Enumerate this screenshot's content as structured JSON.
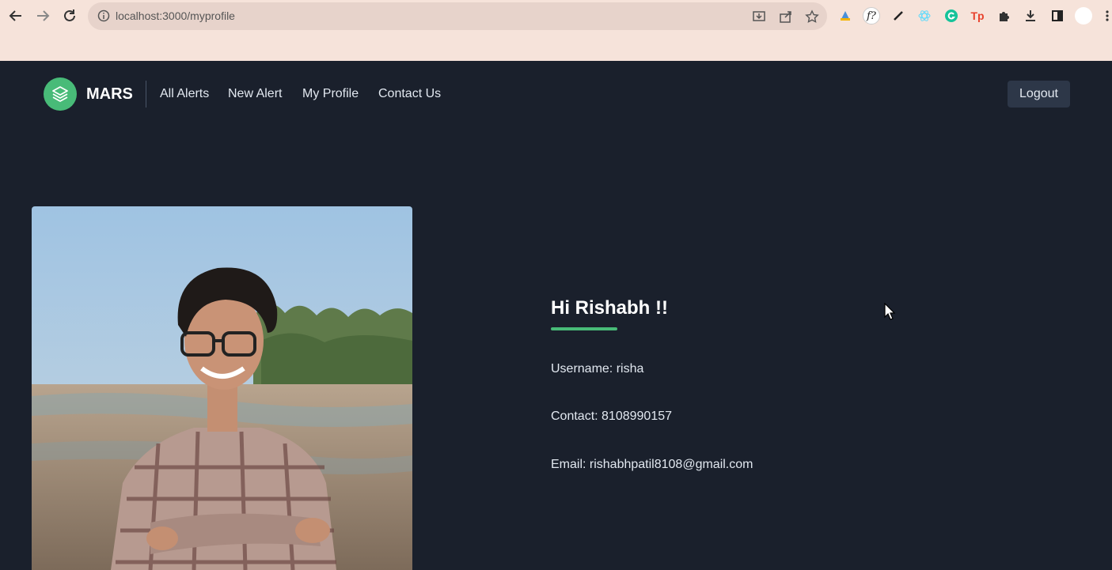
{
  "browser": {
    "url": "localhost:3000/myprofile"
  },
  "header": {
    "brand": "MARS",
    "nav": [
      "All Alerts",
      "New Alert",
      "My Profile",
      "Contact Us"
    ],
    "logout_label": "Logout"
  },
  "profile": {
    "greeting": "Hi Rishabh !!",
    "username": "Username: risha",
    "contact": "Contact: 8108990157",
    "email": "Email: rishabhpatil8108@gmail.com"
  },
  "colors": {
    "background": "#1a202c",
    "accent": "#48bb78",
    "chrome": "#f6e3da"
  }
}
